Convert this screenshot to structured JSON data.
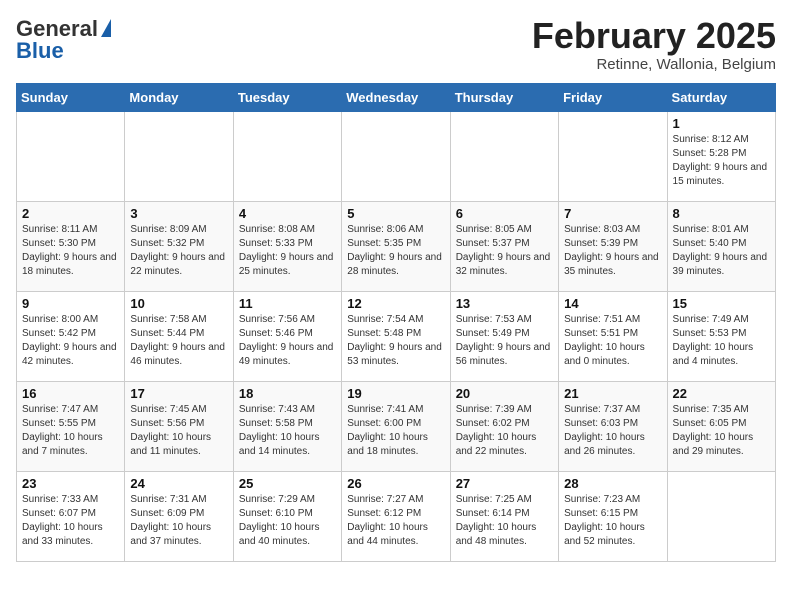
{
  "header": {
    "logo_general": "General",
    "logo_blue": "Blue",
    "month_title": "February 2025",
    "location": "Retinne, Wallonia, Belgium"
  },
  "days_of_week": [
    "Sunday",
    "Monday",
    "Tuesday",
    "Wednesday",
    "Thursday",
    "Friday",
    "Saturday"
  ],
  "weeks": [
    [
      {
        "day": "",
        "content": ""
      },
      {
        "day": "",
        "content": ""
      },
      {
        "day": "",
        "content": ""
      },
      {
        "day": "",
        "content": ""
      },
      {
        "day": "",
        "content": ""
      },
      {
        "day": "",
        "content": ""
      },
      {
        "day": "1",
        "content": "Sunrise: 8:12 AM\nSunset: 5:28 PM\nDaylight: 9 hours and 15 minutes."
      }
    ],
    [
      {
        "day": "2",
        "content": "Sunrise: 8:11 AM\nSunset: 5:30 PM\nDaylight: 9 hours and 18 minutes."
      },
      {
        "day": "3",
        "content": "Sunrise: 8:09 AM\nSunset: 5:32 PM\nDaylight: 9 hours and 22 minutes."
      },
      {
        "day": "4",
        "content": "Sunrise: 8:08 AM\nSunset: 5:33 PM\nDaylight: 9 hours and 25 minutes."
      },
      {
        "day": "5",
        "content": "Sunrise: 8:06 AM\nSunset: 5:35 PM\nDaylight: 9 hours and 28 minutes."
      },
      {
        "day": "6",
        "content": "Sunrise: 8:05 AM\nSunset: 5:37 PM\nDaylight: 9 hours and 32 minutes."
      },
      {
        "day": "7",
        "content": "Sunrise: 8:03 AM\nSunset: 5:39 PM\nDaylight: 9 hours and 35 minutes."
      },
      {
        "day": "8",
        "content": "Sunrise: 8:01 AM\nSunset: 5:40 PM\nDaylight: 9 hours and 39 minutes."
      }
    ],
    [
      {
        "day": "9",
        "content": "Sunrise: 8:00 AM\nSunset: 5:42 PM\nDaylight: 9 hours and 42 minutes."
      },
      {
        "day": "10",
        "content": "Sunrise: 7:58 AM\nSunset: 5:44 PM\nDaylight: 9 hours and 46 minutes."
      },
      {
        "day": "11",
        "content": "Sunrise: 7:56 AM\nSunset: 5:46 PM\nDaylight: 9 hours and 49 minutes."
      },
      {
        "day": "12",
        "content": "Sunrise: 7:54 AM\nSunset: 5:48 PM\nDaylight: 9 hours and 53 minutes."
      },
      {
        "day": "13",
        "content": "Sunrise: 7:53 AM\nSunset: 5:49 PM\nDaylight: 9 hours and 56 minutes."
      },
      {
        "day": "14",
        "content": "Sunrise: 7:51 AM\nSunset: 5:51 PM\nDaylight: 10 hours and 0 minutes."
      },
      {
        "day": "15",
        "content": "Sunrise: 7:49 AM\nSunset: 5:53 PM\nDaylight: 10 hours and 4 minutes."
      }
    ],
    [
      {
        "day": "16",
        "content": "Sunrise: 7:47 AM\nSunset: 5:55 PM\nDaylight: 10 hours and 7 minutes."
      },
      {
        "day": "17",
        "content": "Sunrise: 7:45 AM\nSunset: 5:56 PM\nDaylight: 10 hours and 11 minutes."
      },
      {
        "day": "18",
        "content": "Sunrise: 7:43 AM\nSunset: 5:58 PM\nDaylight: 10 hours and 14 minutes."
      },
      {
        "day": "19",
        "content": "Sunrise: 7:41 AM\nSunset: 6:00 PM\nDaylight: 10 hours and 18 minutes."
      },
      {
        "day": "20",
        "content": "Sunrise: 7:39 AM\nSunset: 6:02 PM\nDaylight: 10 hours and 22 minutes."
      },
      {
        "day": "21",
        "content": "Sunrise: 7:37 AM\nSunset: 6:03 PM\nDaylight: 10 hours and 26 minutes."
      },
      {
        "day": "22",
        "content": "Sunrise: 7:35 AM\nSunset: 6:05 PM\nDaylight: 10 hours and 29 minutes."
      }
    ],
    [
      {
        "day": "23",
        "content": "Sunrise: 7:33 AM\nSunset: 6:07 PM\nDaylight: 10 hours and 33 minutes."
      },
      {
        "day": "24",
        "content": "Sunrise: 7:31 AM\nSunset: 6:09 PM\nDaylight: 10 hours and 37 minutes."
      },
      {
        "day": "25",
        "content": "Sunrise: 7:29 AM\nSunset: 6:10 PM\nDaylight: 10 hours and 40 minutes."
      },
      {
        "day": "26",
        "content": "Sunrise: 7:27 AM\nSunset: 6:12 PM\nDaylight: 10 hours and 44 minutes."
      },
      {
        "day": "27",
        "content": "Sunrise: 7:25 AM\nSunset: 6:14 PM\nDaylight: 10 hours and 48 minutes."
      },
      {
        "day": "28",
        "content": "Sunrise: 7:23 AM\nSunset: 6:15 PM\nDaylight: 10 hours and 52 minutes."
      },
      {
        "day": "",
        "content": ""
      }
    ]
  ]
}
